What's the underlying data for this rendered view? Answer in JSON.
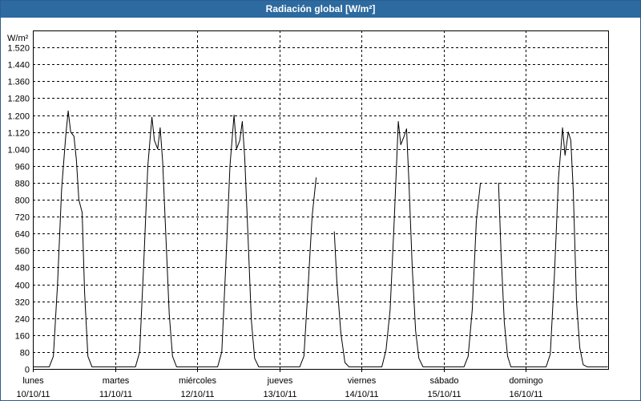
{
  "window": {
    "title": "Radiación global [W/m²]"
  },
  "chart_data": {
    "type": "line",
    "title": "Radiación global [W/m²]",
    "ylabel": "W/m²",
    "xlabel": "",
    "ylim": [
      0,
      1600
    ],
    "xlim": [
      0,
      7
    ],
    "grid": true,
    "yticks": [
      0,
      80,
      160,
      240,
      320,
      400,
      480,
      560,
      640,
      720,
      800,
      880,
      960,
      1040,
      1120,
      1200,
      1280,
      1360,
      1440,
      1520
    ],
    "ytick_labels": [
      "0",
      "80",
      "160",
      "240",
      "320",
      "400",
      "480",
      "560",
      "640",
      "720",
      "800",
      "880",
      "960",
      "1.040",
      "1.120",
      "1.200",
      "1.280",
      "1.360",
      "1.440",
      "1.520"
    ],
    "xticks": [
      {
        "x": 0,
        "day": "lunes",
        "date": "10/10/11"
      },
      {
        "x": 1,
        "day": "martes",
        "date": "11/10/11"
      },
      {
        "x": 2,
        "day": "miércoles",
        "date": "12/10/11"
      },
      {
        "x": 3,
        "day": "jueves",
        "date": "13/10/11"
      },
      {
        "x": 4,
        "day": "viernes",
        "date": "14/10/11"
      },
      {
        "x": 5,
        "day": "sábado",
        "date": "15/10/11"
      },
      {
        "x": 6,
        "day": "domingo",
        "date": "16/10/11"
      }
    ],
    "series": [
      {
        "color": "#000000",
        "segments": [
          [
            [
              0,
              10
            ],
            [
              0.2,
              10
            ],
            [
              0.25,
              60
            ],
            [
              0.3,
              400
            ],
            [
              0.35,
              850
            ],
            [
              0.4,
              1100
            ],
            [
              0.43,
              1220
            ],
            [
              0.46,
              1120
            ],
            [
              0.5,
              1100
            ],
            [
              0.53,
              990
            ],
            [
              0.56,
              800
            ],
            [
              0.6,
              740
            ],
            [
              0.63,
              360
            ],
            [
              0.67,
              60
            ],
            [
              0.72,
              10
            ],
            [
              1.25,
              10
            ],
            [
              1.3,
              80
            ],
            [
              1.35,
              500
            ],
            [
              1.4,
              960
            ],
            [
              1.45,
              1190
            ],
            [
              1.48,
              1080
            ],
            [
              1.52,
              1040
            ],
            [
              1.55,
              1140
            ],
            [
              1.58,
              980
            ],
            [
              1.62,
              620
            ],
            [
              1.66,
              260
            ],
            [
              1.7,
              60
            ],
            [
              1.75,
              10
            ],
            [
              2.25,
              10
            ],
            [
              2.3,
              80
            ],
            [
              2.35,
              500
            ],
            [
              2.4,
              960
            ],
            [
              2.45,
              1200
            ],
            [
              2.48,
              1040
            ],
            [
              2.52,
              1080
            ],
            [
              2.55,
              1170
            ],
            [
              2.58,
              1000
            ],
            [
              2.62,
              620
            ],
            [
              2.66,
              230
            ],
            [
              2.7,
              50
            ],
            [
              2.75,
              10
            ],
            [
              3.25,
              10
            ],
            [
              3.3,
              60
            ],
            [
              3.35,
              380
            ],
            [
              3.4,
              720
            ],
            [
              3.45,
              905
            ]
          ],
          [
            [
              3.67,
              650
            ],
            [
              3.7,
              420
            ],
            [
              3.75,
              170
            ],
            [
              3.8,
              30
            ],
            [
              3.85,
              10
            ],
            [
              4.25,
              10
            ],
            [
              4.3,
              90
            ],
            [
              4.35,
              280
            ],
            [
              4.4,
              700
            ],
            [
              4.45,
              1170
            ],
            [
              4.48,
              1060
            ],
            [
              4.52,
              1100
            ],
            [
              4.55,
              1135
            ],
            [
              4.58,
              880
            ],
            [
              4.62,
              480
            ],
            [
              4.66,
              180
            ],
            [
              4.7,
              50
            ],
            [
              4.75,
              10
            ],
            [
              5.25,
              10
            ],
            [
              5.3,
              60
            ],
            [
              5.35,
              280
            ],
            [
              5.4,
              700
            ],
            [
              5.45,
              880
            ]
          ],
          [
            [
              5.67,
              880
            ],
            [
              5.7,
              550
            ],
            [
              5.74,
              220
            ],
            [
              5.78,
              60
            ],
            [
              5.82,
              10
            ],
            [
              6.25,
              10
            ],
            [
              6.3,
              70
            ],
            [
              6.35,
              440
            ],
            [
              6.4,
              900
            ],
            [
              6.45,
              1140
            ],
            [
              6.48,
              1010
            ],
            [
              6.52,
              1120
            ],
            [
              6.55,
              1080
            ],
            [
              6.58,
              840
            ],
            [
              6.62,
              320
            ],
            [
              6.66,
              100
            ],
            [
              6.7,
              20
            ],
            [
              6.75,
              10
            ],
            [
              7,
              10
            ]
          ]
        ]
      }
    ]
  }
}
